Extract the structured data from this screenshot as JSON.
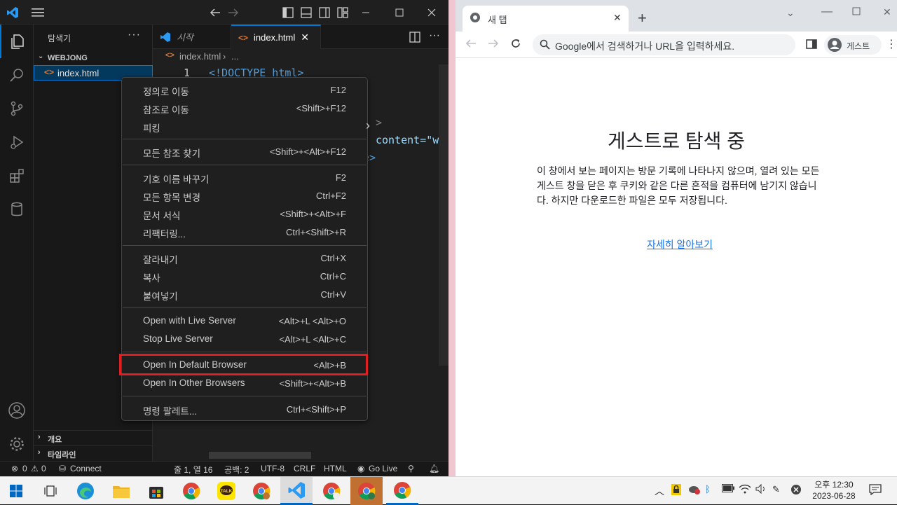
{
  "vscode": {
    "sidebar_title": "탐색기",
    "folder_name": "WEBJONG",
    "file_name": "index.html",
    "section_outline": "개요",
    "section_timeline": "타임라인",
    "tabs": [
      {
        "label": "시작"
      },
      {
        "label": "index.html"
      }
    ],
    "breadcrumb_file": "index.html",
    "breadcrumb_rest": "...",
    "line_number": "1",
    "code_line1": "<!DOCTYPE html>",
    "code_frag_content": "content=\"wi",
    "code_frag_e": "e>",
    "status": {
      "errors": "0",
      "warnings": "0",
      "connect": "Connect",
      "position": "줄 1, 열 16",
      "spaces": "공백: 2",
      "encoding": "UTF-8",
      "eol": "CRLF",
      "language": "HTML",
      "golive": "Go Live"
    }
  },
  "context_menu": {
    "items": [
      {
        "label": "정의로 이동",
        "shortcut": "F12"
      },
      {
        "label": "참조로 이동",
        "shortcut": "<Shift>+F12"
      },
      {
        "label": "피킹",
        "shortcut": "›"
      },
      {
        "label": "모든 참조 찾기",
        "shortcut": "<Shift>+<Alt>+F12"
      },
      {
        "label": "기호 이름 바꾸기",
        "shortcut": "F2"
      },
      {
        "label": "모든 항목 변경",
        "shortcut": "Ctrl+F2"
      },
      {
        "label": "문서 서식",
        "shortcut": "<Shift>+<Alt>+F"
      },
      {
        "label": "리팩터링...",
        "shortcut": "Ctrl+<Shift>+R"
      },
      {
        "label": "잘라내기",
        "shortcut": "Ctrl+X"
      },
      {
        "label": "복사",
        "shortcut": "Ctrl+C"
      },
      {
        "label": "붙여넣기",
        "shortcut": "Ctrl+V"
      },
      {
        "label": "Open with Live Server",
        "shortcut": "<Alt>+L <Alt>+O"
      },
      {
        "label": "Stop Live Server",
        "shortcut": "<Alt>+L <Alt>+C"
      },
      {
        "label": "Open In Default Browser",
        "shortcut": "<Alt>+B"
      },
      {
        "label": "Open In Other Browsers",
        "shortcut": "<Shift>+<Alt>+B"
      },
      {
        "label": "명령 팔레트...",
        "shortcut": "Ctrl+<Shift>+P"
      }
    ]
  },
  "chrome": {
    "tab_title": "새 탭",
    "address_placeholder": "Google에서 검색하거나 URL을 입력하세요.",
    "profile_label": "게스트",
    "heading": "게스트로 탐색 중",
    "paragraph": "이 창에서 보는 페이지는 방문 기록에 나타나지 않으며, 열려 있는 모든 게스트 창을 닫은 후 쿠키와 같은 다른 흔적을 컴퓨터에 남기지 않습니다. 하지만 다운로드한 파일은 모두 저장됩니다.",
    "learn_more": "자세히 알아보기"
  },
  "taskbar": {
    "time": "오후 12:30",
    "date": "2023-06-28"
  },
  "colors": {
    "vscode_bg": "#1f1f1f",
    "accent_blue": "#0078d4",
    "highlight_red": "#e02020",
    "link_blue": "#1a73e8"
  }
}
